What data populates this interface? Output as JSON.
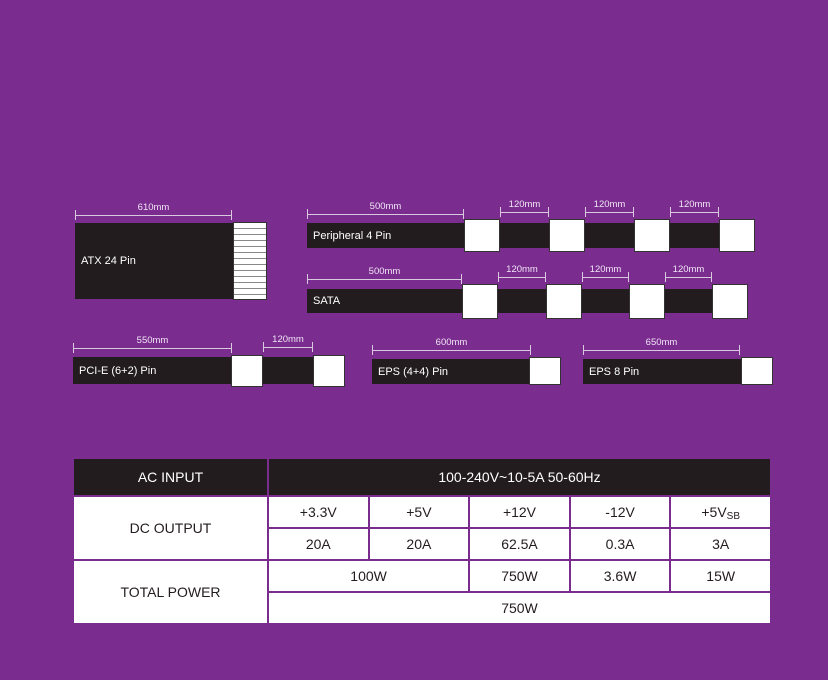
{
  "cables": {
    "atx": {
      "label": "ATX 24 Pin",
      "length": "610mm"
    },
    "peripheral": {
      "label": "Peripheral 4 Pin",
      "length": "500mm",
      "segments": [
        "120mm",
        "120mm",
        "120mm"
      ]
    },
    "sata": {
      "label": "SATA",
      "length": "500mm",
      "segments": [
        "120mm",
        "120mm",
        "120mm"
      ]
    },
    "pcie": {
      "label": "PCI-E (6+2) Pin",
      "length": "550mm",
      "segment": "120mm"
    },
    "eps44": {
      "label": "EPS (4+4) Pin",
      "length": "600mm"
    },
    "eps8": {
      "label": "EPS 8 Pin",
      "length": "650mm"
    }
  },
  "spec_table": {
    "ac_input_label": "AC INPUT",
    "ac_input_value": "100-240V~10-5A 50-60Hz",
    "dc_output_label": "DC OUTPUT",
    "rails": [
      "+3.3V",
      "+5V",
      "+12V",
      "-12V",
      "+5V"
    ],
    "rail_last_sub": "SB",
    "currents": [
      "20A",
      "20A",
      "62.5A",
      "0.3A",
      "3A"
    ],
    "total_power_label": "TOTAL POWER",
    "power_33_5": "100W",
    "power_12": "750W",
    "power_neg12": "3.6W",
    "power_5sb": "15W",
    "total": "750W"
  }
}
